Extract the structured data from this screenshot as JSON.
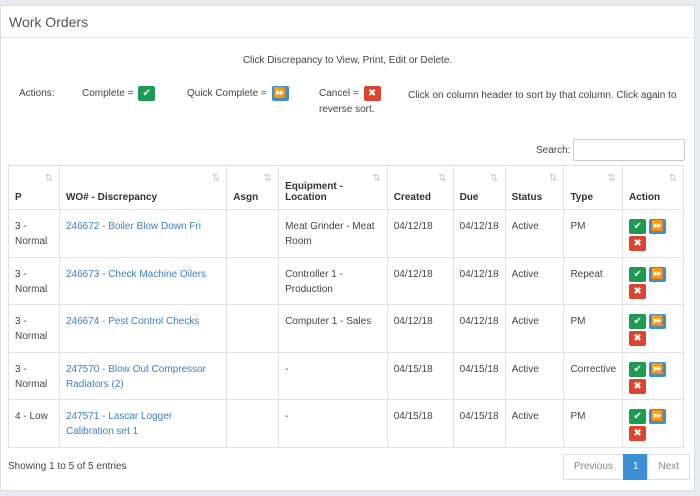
{
  "panel": {
    "title": "Work Orders"
  },
  "info_text": "Click Discrepancy to View, Print, Edit or Delete.",
  "actions": {
    "label": "Actions:",
    "complete_label": "Complete =",
    "quick_complete_label": "Quick Complete =",
    "cancel_label": "Cancel =",
    "sort_note_part1": "Click on column header to sort by that column. Click again to",
    "sort_note_part2": "reverse sort.",
    "icons": {
      "complete": "check-icon",
      "quick_complete": "fast-forward-icon",
      "cancel": "close-icon"
    }
  },
  "search": {
    "label": "Search:",
    "value": ""
  },
  "table": {
    "headers": {
      "p": "P",
      "wo": "WO# - Discrepancy",
      "asgn": "Asgn",
      "equipment": "Equipment - Location",
      "created": "Created",
      "due": "Due",
      "status": "Status",
      "type": "Type",
      "action": "Action"
    },
    "rows": [
      {
        "p": "3 - Normal",
        "wo": "246672 - Boiler Blow Down Fri",
        "asgn": "",
        "equipment": "Meat Grinder - Meat Room",
        "created": "04/12/18",
        "due": "04/12/18",
        "status": "Active",
        "type": "PM"
      },
      {
        "p": "3 - Normal",
        "wo": "246673 - Check Machine Oilers",
        "asgn": "",
        "equipment": "Controller 1 - Production",
        "created": "04/12/18",
        "due": "04/12/18",
        "status": "Active",
        "type": "Repeat"
      },
      {
        "p": "3 - Normal",
        "wo": "246674 - Pest Control Checks",
        "asgn": "",
        "equipment": "Computer 1 - Sales",
        "created": "04/12/18",
        "due": "04/12/18",
        "status": "Active",
        "type": "PM"
      },
      {
        "p": "3 - Normal",
        "wo": "247570 - Blow Out Compressor Radiators (2)",
        "asgn": "",
        "equipment": "-",
        "created": "04/15/18",
        "due": "04/15/18",
        "status": "Active",
        "type": "Corrective"
      },
      {
        "p": "4 - Low",
        "wo": "247571 - Lascar Logger Calibration set 1",
        "asgn": "",
        "equipment": "-",
        "created": "04/15/18",
        "due": "04/15/18",
        "status": "Active",
        "type": "PM"
      }
    ]
  },
  "footer": {
    "info": "Showing 1 to 5 of 5 entries",
    "prev": "Previous",
    "page": "1",
    "next": "Next"
  },
  "colors": {
    "complete": "#1e9b53",
    "quick_complete": "#3c8fd2",
    "cancel": "#d9452f",
    "link": "#3b7fc4"
  }
}
